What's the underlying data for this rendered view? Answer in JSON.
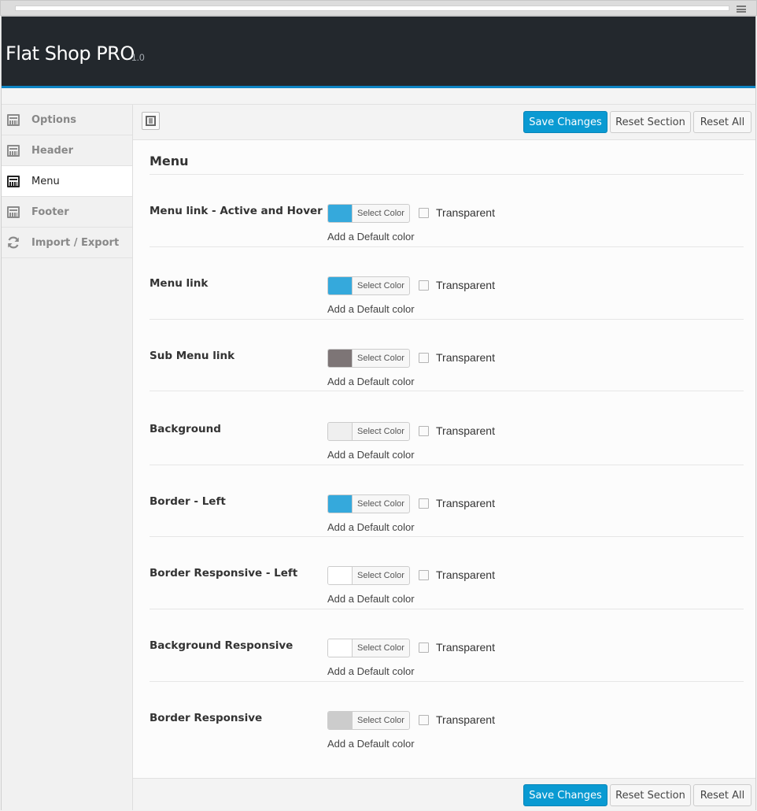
{
  "app": {
    "title": "Flat Shop PRO",
    "version": "1.0"
  },
  "sidebar": {
    "items": [
      {
        "label": "Options",
        "icon": "window-icon",
        "active": false
      },
      {
        "label": "Header",
        "icon": "window-icon",
        "active": false
      },
      {
        "label": "Menu",
        "icon": "window-icon",
        "active": true
      },
      {
        "label": "Footer",
        "icon": "window-icon",
        "active": false
      },
      {
        "label": "Import / Export",
        "icon": "refresh-icon",
        "active": false
      }
    ]
  },
  "toolbar": {
    "save_label": "Save Changes",
    "reset_section_label": "Reset Section",
    "reset_all_label": "Reset All",
    "layout_icon": "layout-icon"
  },
  "section": {
    "title": "Menu"
  },
  "fields": [
    {
      "label": "Menu link - Active and Hover",
      "color": "#35a9dc",
      "button": "Select Color",
      "transparent_label": "Transparent",
      "default_link": "Add a Default color"
    },
    {
      "label": "Menu link",
      "color": "#35a9dc",
      "button": "Select Color",
      "transparent_label": "Transparent",
      "default_link": "Add a Default color"
    },
    {
      "label": "Sub Menu link",
      "color": "#7d7576",
      "button": "Select Color",
      "transparent_label": "Transparent",
      "default_link": "Add a Default color"
    },
    {
      "label": "Background",
      "color": "#efefef",
      "button": "Select Color",
      "transparent_label": "Transparent",
      "default_link": "Add a Default color"
    },
    {
      "label": "Border - Left",
      "color": "#35a9dc",
      "button": "Select Color",
      "transparent_label": "Transparent",
      "default_link": "Add a Default color"
    },
    {
      "label": "Border Responsive - Left",
      "color": "#ffffff",
      "button": "Select Color",
      "transparent_label": "Transparent",
      "default_link": "Add a Default color"
    },
    {
      "label": "Background Responsive",
      "color": "#ffffff",
      "button": "Select Color",
      "transparent_label": "Transparent",
      "default_link": "Add a Default color"
    },
    {
      "label": "Border Responsive",
      "color": "#cccccc",
      "button": "Select Color",
      "transparent_label": "Transparent",
      "default_link": "Add a Default color"
    }
  ],
  "colors": {
    "header_bg": "#23282d",
    "accent": "#0a9ad2",
    "header_border": "#0e85c4"
  }
}
